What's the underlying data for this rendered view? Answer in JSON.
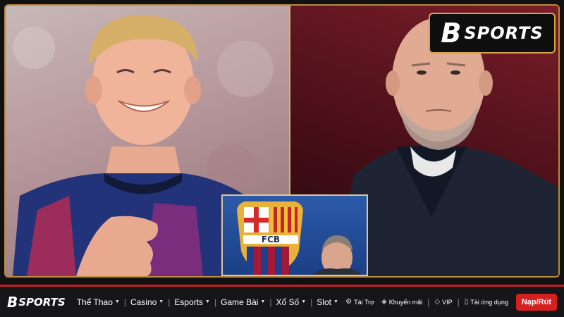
{
  "banner": {
    "brand_mark": "B",
    "brand_text": "SPORTS",
    "crest_text": "FCB"
  },
  "navbar": {
    "logo_mark": "B",
    "logo_text": "SPORTS",
    "items": [
      {
        "label": "Thể Thao"
      },
      {
        "label": "Casino"
      },
      {
        "label": "Esports"
      },
      {
        "label": "Game Bài"
      },
      {
        "label": "Xổ Số"
      },
      {
        "label": "Slot"
      }
    ],
    "utilities": [
      {
        "label": "Tài Trợ",
        "icon": "sponsor-icon"
      },
      {
        "label": "Khuyến mãi",
        "icon": "promo-tag-icon"
      },
      {
        "label": "VIP",
        "icon": "vip-diamond-icon"
      },
      {
        "label": "Tải ứng dụng",
        "icon": "mobile-app-icon"
      }
    ],
    "cta_label": "Nạp/Rút"
  },
  "colors": {
    "accent_red": "#d61f1f",
    "gold_border": "#b98a3a",
    "navbar_bg": "#161618"
  }
}
